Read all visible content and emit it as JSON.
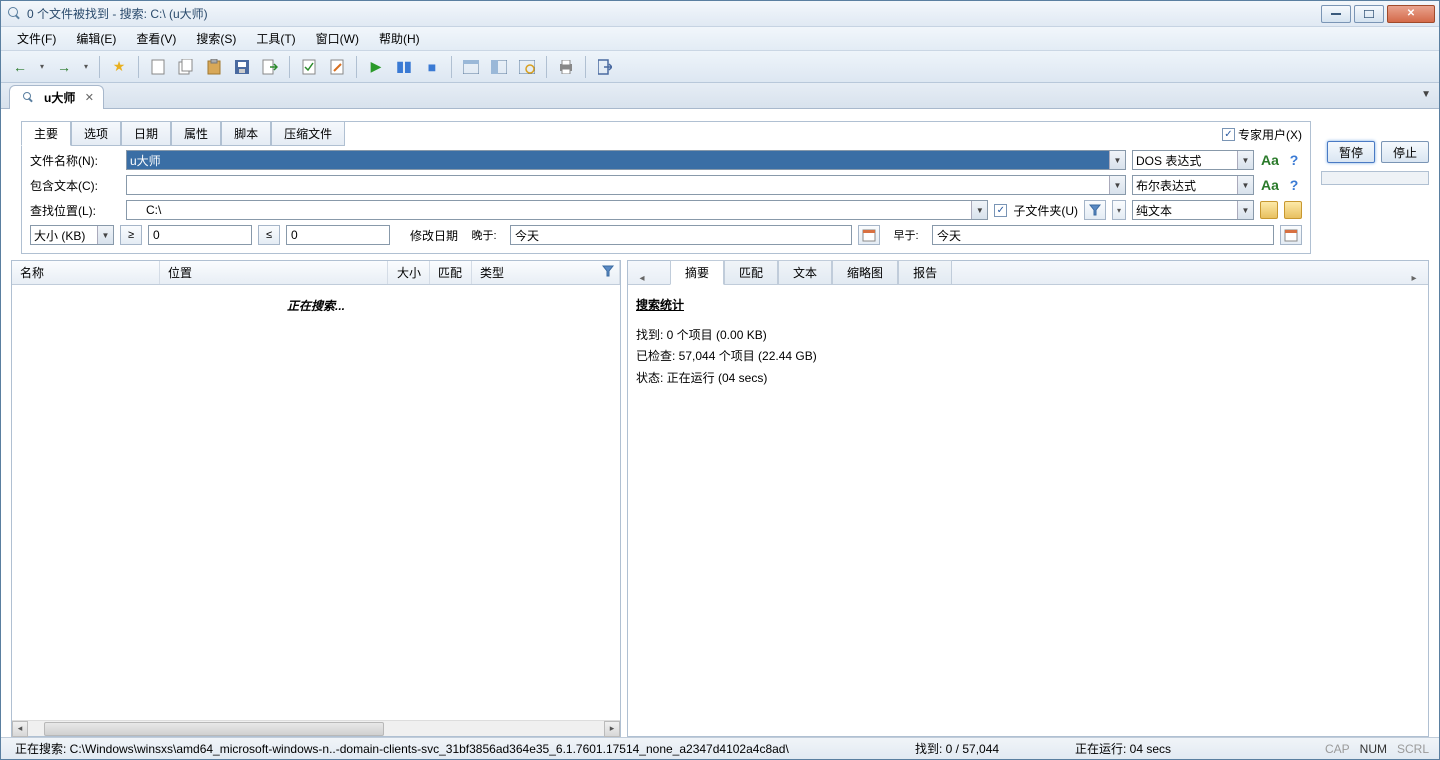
{
  "title": "0 个文件被找到 - 搜索: C:\\ (u大师)",
  "menu": [
    "文件(F)",
    "编辑(E)",
    "查看(V)",
    "搜索(S)",
    "工具(T)",
    "窗口(W)",
    "帮助(H)"
  ],
  "search_tab": {
    "label": "u大师"
  },
  "criteria_tabs": [
    "主要",
    "选项",
    "日期",
    "属性",
    "脚本",
    "压缩文件"
  ],
  "expert_label": "专家用户(X)",
  "labels": {
    "fname": "文件名称(N):",
    "contains": "包含文本(C):",
    "lookin": "查找位置(L):",
    "size": "大小 (KB)",
    "moddate": "修改日期",
    "later": "晚于:",
    "earlier": "早于:",
    "subfolders": "子文件夹(U)"
  },
  "values": {
    "fname": "u大师",
    "contains": "",
    "lookin": "C:\\",
    "size_min": "0",
    "size_max": "0",
    "date_later": "今天",
    "date_earlier": "今天"
  },
  "expr": {
    "fname": "DOS 表达式",
    "contains": "布尔表达式",
    "lookin": "纯文本"
  },
  "buttons": {
    "pause": "暂停",
    "stop": "停止"
  },
  "result_cols": {
    "name": "名称",
    "location": "位置",
    "size": "大小",
    "match": "匹配",
    "type": "类型"
  },
  "searching_text": "正在搜索...",
  "right_tabs": [
    "摘要",
    "匹配",
    "文本",
    "缩略图",
    "报告"
  ],
  "summary": {
    "heading": "搜索统计",
    "found": "找到: 0 个项目 (0.00 KB)",
    "checked": "已检查: 57,044 个项目 (22.44 GB)",
    "status": "状态: 正在运行 (04 secs)"
  },
  "status": {
    "path": "正在搜索: C:\\Windows\\winsxs\\amd64_microsoft-windows-n..-domain-clients-svc_31bf3856ad364e35_6.1.7601.17514_none_a2347d4102a4c8ad\\",
    "found": "找到: 0 / 57,044",
    "running": "正在运行: 04 secs",
    "cap": "CAP",
    "num": "NUM",
    "scrl": "SCRL"
  }
}
